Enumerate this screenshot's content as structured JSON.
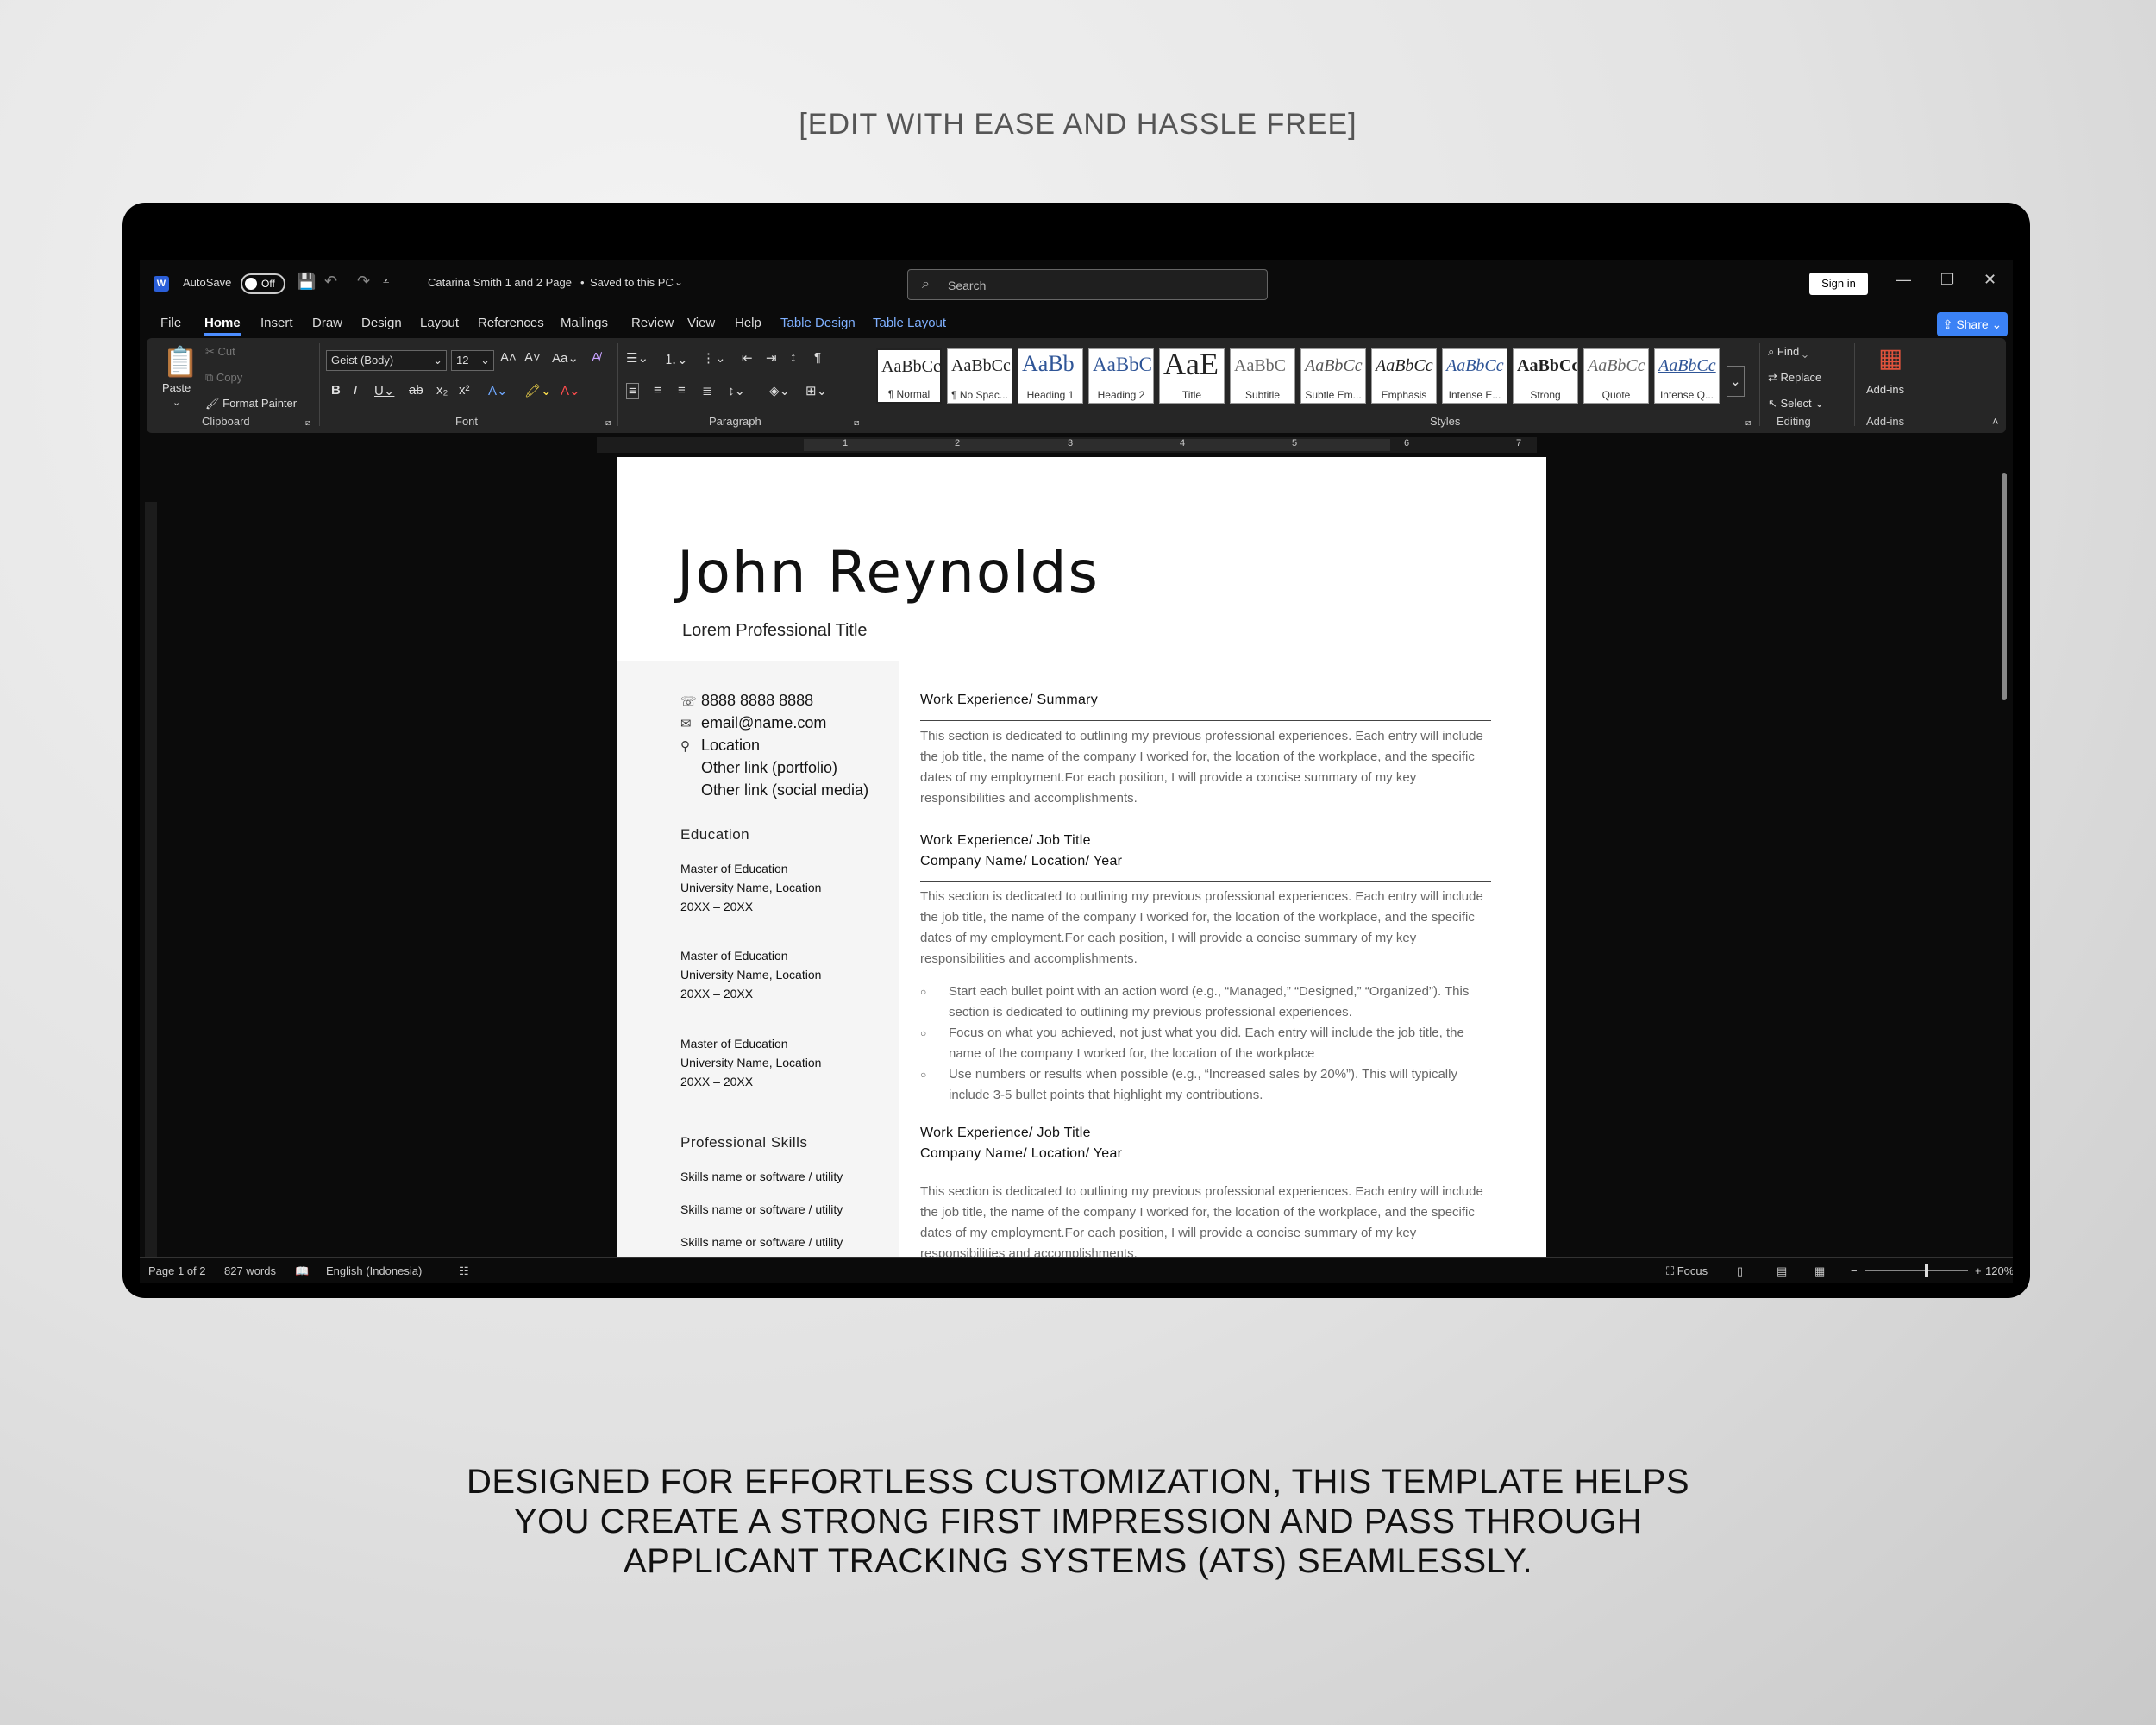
{
  "marketing": {
    "tagline": "[EDIT WITH EASE AND HASSLE FREE]",
    "description_lines": [
      "DESIGNED FOR EFFORTLESS CUSTOMIZATION, THIS TEMPLATE HELPS",
      "YOU CREATE A STRONG FIRST IMPRESSION AND PASS THROUGH",
      "APPLICANT TRACKING SYSTEMS (ATS) SEAMLESSLY."
    ]
  },
  "titlebar": {
    "autosave_label": "AutoSave",
    "autosave_state": "Off",
    "document_title": "Catarina Smith 1 and 2 Page",
    "save_status": "Saved to this PC",
    "search_placeholder": "Search",
    "signin_label": "Sign in"
  },
  "menu": {
    "tabs": [
      "File",
      "Home",
      "Insert",
      "Draw",
      "Design",
      "Layout",
      "References",
      "Mailings",
      "Review",
      "View",
      "Help",
      "Table Design",
      "Table Layout"
    ],
    "active_tab": "Home",
    "share_label": "Share"
  },
  "ribbon": {
    "clipboard": {
      "paste": "Paste",
      "cut": "Cut",
      "copy": "Copy",
      "format_painter": "Format Painter",
      "label": "Clipboard"
    },
    "font": {
      "family": "Geist (Body)",
      "size": "12",
      "label": "Font"
    },
    "paragraph": {
      "label": "Paragraph"
    },
    "styles": {
      "label": "Styles",
      "items": [
        {
          "preview": "AaBbCc",
          "name": "¶ Normal"
        },
        {
          "preview": "AaBbCc",
          "name": "¶ No Spac..."
        },
        {
          "preview": "AaBb",
          "name": "Heading 1"
        },
        {
          "preview": "AaBbC",
          "name": "Heading 2"
        },
        {
          "preview": "AaE",
          "name": "Title"
        },
        {
          "preview": "AaBbC",
          "name": "Subtitle"
        },
        {
          "preview": "AaBbCc",
          "name": "Subtle Em..."
        },
        {
          "preview": "AaBbCc",
          "name": "Emphasis"
        },
        {
          "preview": "AaBbCc",
          "name": "Intense E..."
        },
        {
          "preview": "AaBbCc",
          "name": "Strong"
        },
        {
          "preview": "AaBbCc",
          "name": "Quote"
        },
        {
          "preview": "AaBbCc",
          "name": "Intense Q..."
        }
      ]
    },
    "editing": {
      "find": "Find",
      "replace": "Replace",
      "select": "Select",
      "label": "Editing"
    },
    "addins": {
      "button": "Add-ins",
      "label": "Add-ins"
    }
  },
  "ruler": {
    "numbers": [
      "1",
      "2",
      "3",
      "4",
      "5",
      "6",
      "7"
    ]
  },
  "resume": {
    "name": "John Reynolds",
    "title": "Lorem Professional Title",
    "contact": {
      "phone": "8888 8888 8888",
      "email": "email@name.com",
      "location": "Location",
      "link_portfolio": "Other link (portfolio)",
      "link_social": "Other link (social media)"
    },
    "education_heading": "Education",
    "education": [
      {
        "degree": "Master of Education",
        "school": "University Name, Location",
        "years": "20XX – 20XX"
      },
      {
        "degree": "Master of Education",
        "school": "University Name, Location",
        "years": "20XX – 20XX"
      },
      {
        "degree": "Master of Education",
        "school": "University Name, Location",
        "years": "20XX – 20XX"
      }
    ],
    "skills_heading": "Professional Skills",
    "skills": [
      "Skills name or software / utility",
      "Skills name or software / utility",
      "Skills name or software / utility"
    ],
    "summary_heading": "Work Experience/ Summary",
    "summary_text": "This section is dedicated to outlining my previous professional experiences. Each entry will include the job title, the name of the company I worked for, the location of the workplace, and the specific dates of my employment.For each position, I will provide a concise summary of my key responsibilities and accomplishments.",
    "job1_heading": "Work Experience/ Job Title",
    "job1_company": "Company Name/ Location/ Year",
    "job1_text": "This section is dedicated to outlining my previous professional experiences. Each entry will include the job title, the name of the company I worked for, the location of the workplace, and the specific dates of my employment.For each position, I will provide a concise summary of my key responsibilities and accomplishments.",
    "bullets": [
      "Start each bullet point with an action word (e.g., “Managed,” “Designed,” “Organized”). This section is dedicated to outlining my previous professional experiences.",
      "Focus on what you achieved, not just what you did. Each entry will include the job title, the name of the company I worked for, the location of the workplace",
      "Use numbers or results when possible (e.g., “Increased sales by 20%”). This will typically include 3-5 bullet points that highlight my contributions."
    ],
    "job2_heading": "Work Experience/ Job Title",
    "job2_company": "Company Name/ Location/ Year",
    "job2_text": "This section is dedicated to outlining my previous professional experiences. Each entry will include the job title, the name of the company I worked for, the location of the workplace, and the specific dates of my employment.For each position, I will provide a concise summary of my key responsibilities and accomplishments."
  },
  "statusbar": {
    "page": "Page 1 of 2",
    "words": "827 words",
    "language": "English (Indonesia)",
    "focus": "Focus",
    "zoom": "120%"
  }
}
